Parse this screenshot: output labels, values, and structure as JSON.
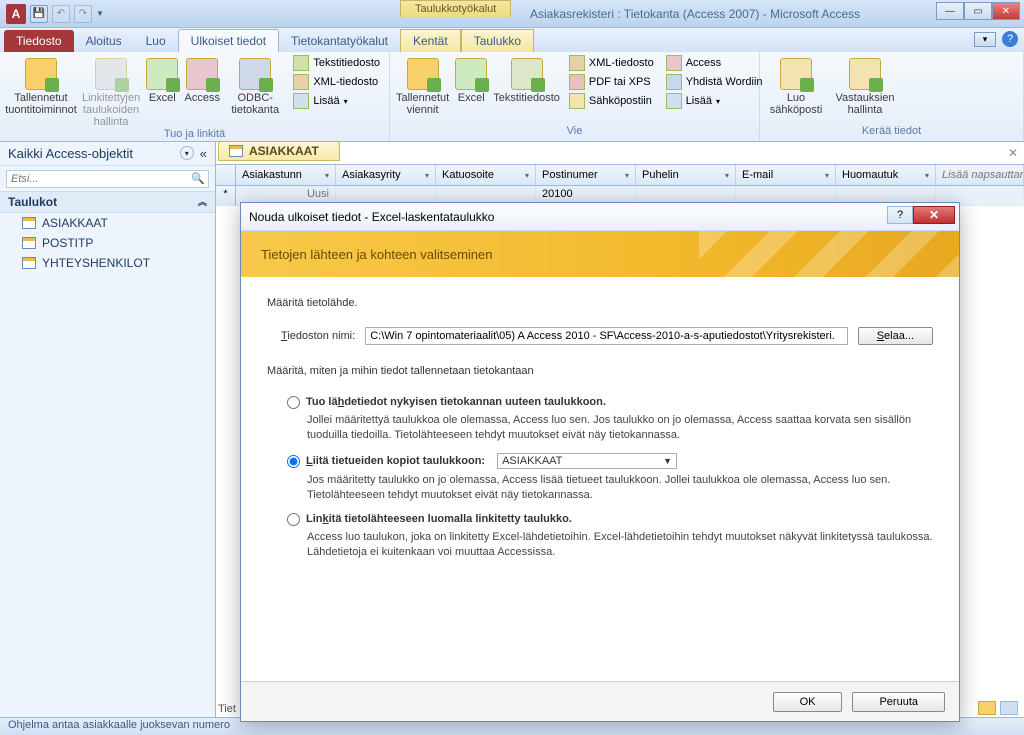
{
  "window": {
    "contextual_tools": "Taulukkotyökalut",
    "title": "Asiakasrekisteri : Tietokanta (Access 2007)  -  Microsoft Access"
  },
  "tabs": {
    "file": "Tiedosto",
    "home": "Aloitus",
    "create": "Luo",
    "external": "Ulkoiset tiedot",
    "dbtools": "Tietokantatyökalut",
    "fields": "Kentät",
    "table": "Taulukko"
  },
  "ribbon": {
    "saved_imports": "Tallennetut tuontitoiminnot",
    "linked_mgr": "Linkitettyjen taulukoiden hallinta",
    "excel": "Excel",
    "access": "Access",
    "odbc": "ODBC-tietokanta",
    "text": "Tekstitiedosto",
    "xml": "XML-tiedosto",
    "more": "Lisää",
    "group_import": "Tuo ja linkitä",
    "saved_exports": "Tallennetut viennit",
    "excel2": "Excel",
    "text2": "Tekstitiedosto",
    "xml2": "XML-tiedosto",
    "pdf": "PDF tai XPS",
    "email": "Sähköpostiin",
    "access2": "Access",
    "word": "Yhdistä Wordiin",
    "more2": "Lisää",
    "group_export": "Vie",
    "create_email": "Luo sähköposti",
    "manage_replies": "Vastauksien hallinta",
    "group_collect": "Kerää tiedot"
  },
  "nav": {
    "header": "Kaikki Access-objektit",
    "search_placeholder": "Etsi...",
    "group_tables": "Taulukot",
    "items": [
      "ASIAKKAAT",
      "POSTITP",
      "YHTEYSHENKILOT"
    ]
  },
  "sheet": {
    "tab": "ASIAKKAAT",
    "columns": [
      "Asiakastunn",
      "Asiakasyrity",
      "Katuosoite",
      "Postinumer",
      "Puhelin",
      "E-mail",
      "Huomautuk"
    ],
    "add_col": "Lisää napsauttamalla",
    "new_row": "Uusi",
    "postinumero_value": "20100",
    "record_label": "Tiet"
  },
  "status": "Ohjelma antaa asiakkaalle juoksevan numero",
  "dialog": {
    "title": "Nouda ulkoiset tiedot - Excel-laskentataulukko",
    "banner": "Tietojen lähteen ja kohteen valitseminen",
    "spec_source": "Määritä tietolähde.",
    "file_label": "Tiedoston nimi:",
    "file_value": "C:\\Win 7 opintomateriaalit\\05) A Access 2010 - SF\\Access-2010-a-s-aputiedostot\\Yritysrekisteri.",
    "browse": "Selaa...",
    "spec_how": "Määritä, miten ja mihin tiedot tallennetaan tietokantaan",
    "opt1_label": "Tuo lähdetiedot nykyisen tietokannan uuteen taulukkoon.",
    "opt1_desc": "Jollei määritettyä taulukkoa ole olemassa, Access luo sen. Jos taulukko on jo olemassa, Access saattaa korvata sen sisällön tuoduilla tiedoilla. Tietolähteeseen tehdyt muutokset eivät näy tietokannassa.",
    "opt2_label": "Liitä tietueiden kopiot taulukkoon:",
    "opt2_combo": "ASIAKKAAT",
    "opt2_desc": "Jos määritetty taulukko on jo olemassa, Access lisää tietueet taulukkoon. Jollei taulukkoa ole olemassa, Access luo sen. Tietolähteeseen tehdyt muutokset eivät näy tietokannassa.",
    "opt3_label": "Linkitä tietolähteeseen luomalla linkitetty taulukko.",
    "opt3_desc": "Access luo taulukon, joka on linkitetty Excel-lähdetietoihin. Excel-lähdetietoihin tehdyt muutokset näkyvät linkitetyssä taulukossa. Lähdetietoja ei kuitenkaan voi muuttaa Accessissa.",
    "ok": "OK",
    "cancel": "Peruuta"
  }
}
